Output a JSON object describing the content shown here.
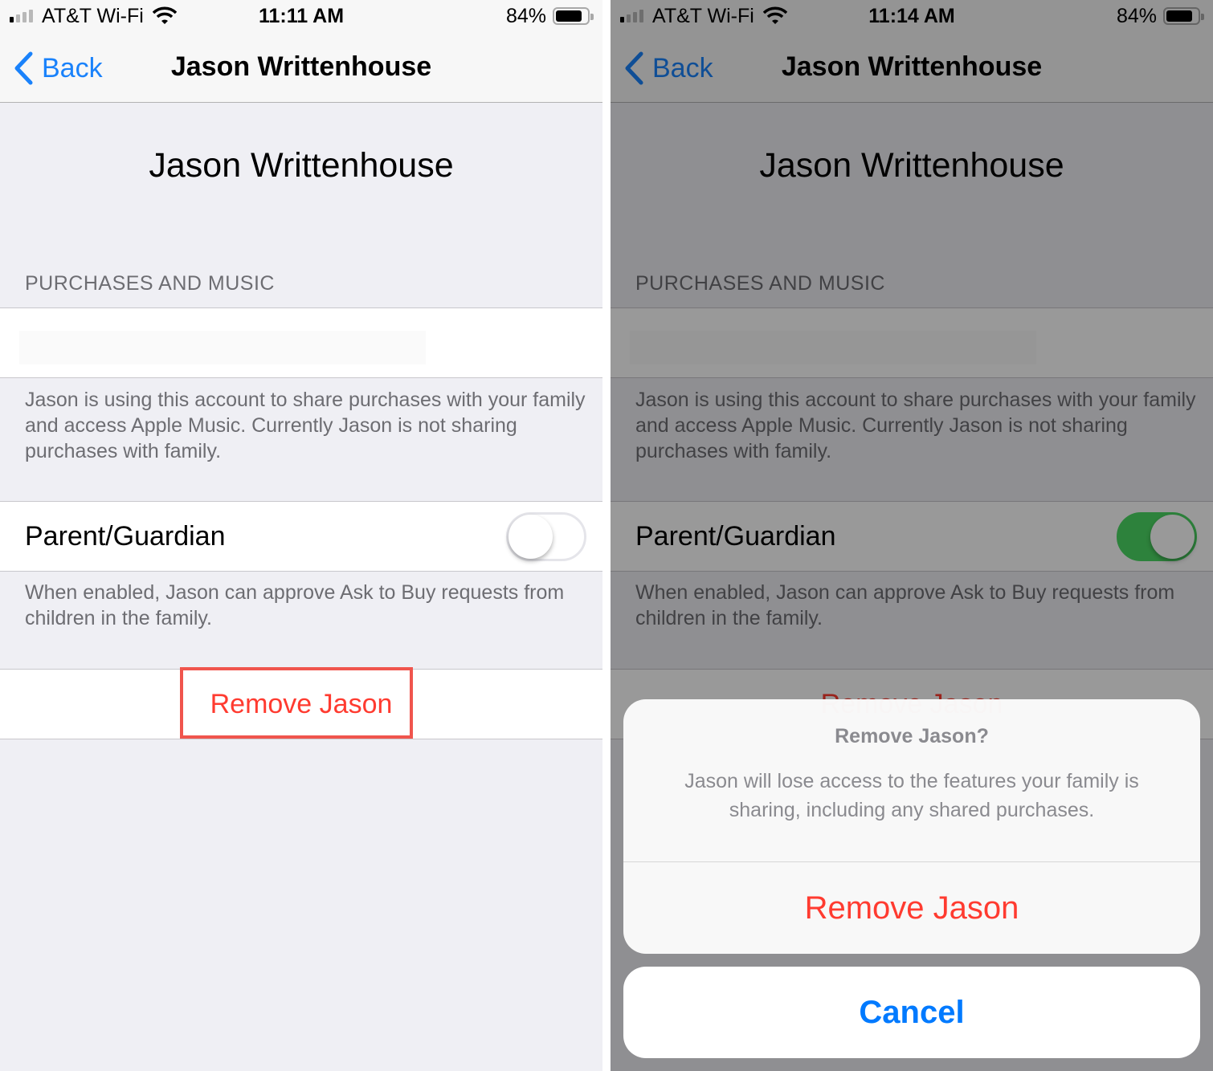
{
  "left": {
    "status_bar": {
      "carrier": "AT&T Wi-Fi",
      "time": "11:11 AM",
      "battery": "84%"
    },
    "nav": {
      "back_label": "Back",
      "title": "Jason Writtenhouse"
    },
    "name_heading": "Jason Writtenhouse",
    "section_header": "PURCHASES AND MUSIC",
    "purchases_footer": "Jason is using this account to share purchases with your family and access Apple Music. Currently Jason is not sharing purchases with family.",
    "parent_guardian": {
      "label": "Parent/Guardian",
      "enabled": false
    },
    "parent_guardian_footer": "When enabled, Jason can approve Ask to Buy requests from children in the family.",
    "remove_label": "Remove Jason",
    "highlight_color": "#f0554d"
  },
  "right": {
    "status_bar": {
      "carrier": "AT&T Wi-Fi",
      "time": "11:14 AM",
      "battery": "84%"
    },
    "nav": {
      "back_label": "Back",
      "title": "Jason Writtenhouse"
    },
    "name_heading": "Jason Writtenhouse",
    "section_header": "PURCHASES AND MUSIC",
    "purchases_footer": "Jason is using this account to share purchases with your family and access Apple Music. Currently Jason is not sharing purchases with family.",
    "parent_guardian": {
      "label": "Parent/Guardian",
      "enabled": true
    },
    "parent_guardian_footer": "When enabled, Jason can approve Ask to Buy requests from children in the family.",
    "remove_label": "Remove Jason",
    "action_sheet": {
      "title": "Remove Jason?",
      "message": "Jason will lose access to the features your family is sharing, including any shared purchases.",
      "destructive_label": "Remove Jason",
      "cancel_label": "Cancel"
    }
  },
  "colors": {
    "ios_blue": "#007aff",
    "ios_red": "#ff3b30",
    "ios_green": "#4cd964"
  }
}
